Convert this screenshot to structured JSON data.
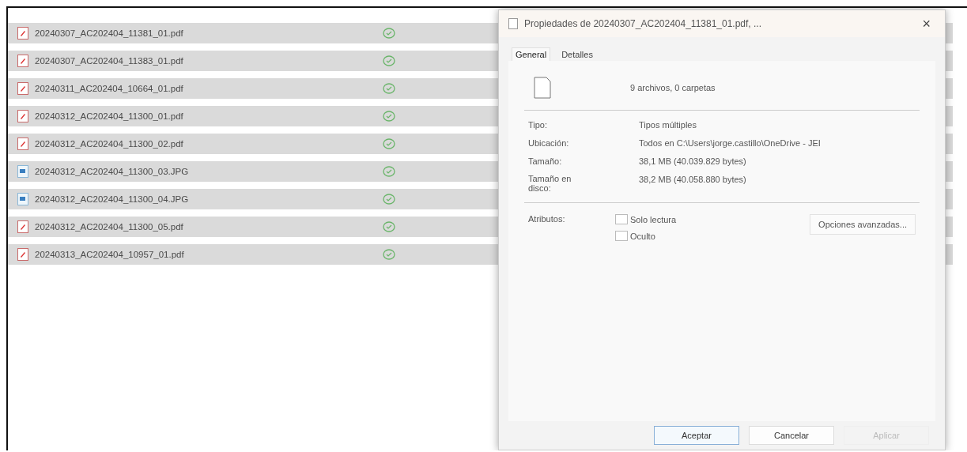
{
  "files": [
    {
      "kind": "pdf",
      "name": "20240307_AC202404_11381_01.pdf",
      "selected": true
    },
    {
      "kind": "pdf",
      "name": "20240307_AC202404_11383_01.pdf",
      "selected": true
    },
    {
      "kind": "pdf",
      "name": "20240311_AC202404_10664_01.pdf",
      "selected": true
    },
    {
      "kind": "pdf",
      "name": "20240312_AC202404_11300_01.pdf",
      "selected": true
    },
    {
      "kind": "pdf",
      "name": "20240312_AC202404_11300_02.pdf",
      "selected": true
    },
    {
      "kind": "image",
      "name": "20240312_AC202404_11300_03.JPG",
      "selected": true
    },
    {
      "kind": "image",
      "name": "20240312_AC202404_11300_04.JPG",
      "selected": true
    },
    {
      "kind": "pdf",
      "name": "20240312_AC202404_11300_05.pdf",
      "selected": true
    },
    {
      "kind": "pdf",
      "name": "20240313_AC202404_10957_01.pdf",
      "selected": true
    }
  ],
  "dialog": {
    "title": "Propiedades de 20240307_AC202404_11381_01.pdf, ...",
    "close": "×",
    "tabs": [
      {
        "label": "General",
        "selected": true
      },
      {
        "label": "Detalles",
        "selected": false
      }
    ],
    "summary": "9 archivos, 0 carpetas",
    "properties": [
      {
        "label": "Tipo:",
        "value": "Tipos múltiples"
      },
      {
        "label": "Ubicación:",
        "value": "Todos en C:\\Users\\jorge.castillo\\OneDrive - JEI"
      },
      {
        "label": "Tamaño:",
        "value": "38,1 MB (40.039.829 bytes)"
      },
      {
        "label": "Tamaño en disco:",
        "value": "38,2 MB (40.058.880 bytes)"
      }
    ],
    "attributes_label": "Atributos:",
    "attributes": [
      {
        "label": "Solo lectura",
        "checked": false
      },
      {
        "label": "Oculto",
        "checked": false
      }
    ],
    "advanced_button": "Opciones avanzadas...",
    "buttons": [
      {
        "label": "Aceptar",
        "disabled": false
      },
      {
        "label": "Cancelar",
        "disabled": false
      },
      {
        "label": "Aplicar",
        "disabled": true
      }
    ]
  }
}
